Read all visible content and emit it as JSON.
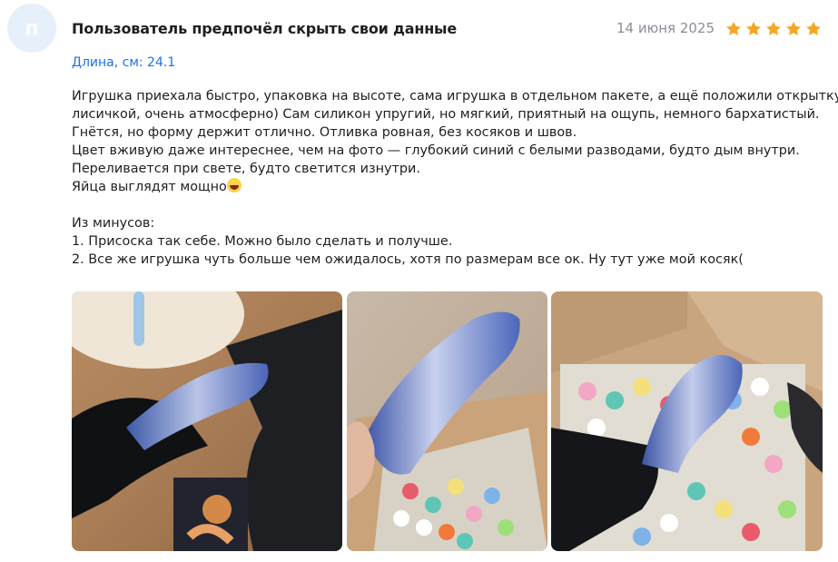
{
  "review": {
    "avatar_letter": "п",
    "author": "Пользователь предпочёл скрыть свои данные",
    "date": "14 июня 2025",
    "rating": 5,
    "star_color": "#f5a623",
    "param": "Длина, см: 24.1",
    "text_lines": [
      "Игрушка приехала быстро, упаковка на высоте, сама игрушка в отдельном пакете, а ещё положили открытку с",
      "лисичкой, очень атмосферно) Сам силикон упругий, но мягкий, приятный на ощупь, немного бархатистый.",
      "Гнётся, но форму держит отлично. Отливка ровная, без косяков и швов.",
      "Цвет вживую даже интереснее, чем на фото — глубокий синий с белыми разводами, будто дым внутри.",
      "Переливается при свете, будто светится изнутри.",
      "Яйца выглядят мощно"
    ],
    "minus_lines": [
      "Из минусов:",
      "1. Присоска так себе. Можно было сделать и получше.",
      "2. Все же игрушка чуть больше чем ожидалось, хотя по размерам все ок. Ну тут уже мой косяк("
    ]
  },
  "photos": [
    {
      "name": "review-photo-1"
    },
    {
      "name": "review-photo-2"
    },
    {
      "name": "review-photo-3"
    }
  ]
}
